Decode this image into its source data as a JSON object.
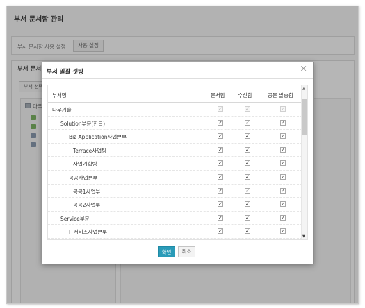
{
  "page": {
    "title": "부서 문서함 관리"
  },
  "setting": {
    "label": "부서 문서함 사용 설정",
    "button": "사용 설정"
  },
  "dept": {
    "title": "부서 문서",
    "select_button": "부서 선택",
    "root_label": "다우"
  },
  "modal": {
    "title": "부서 일괄 셋팅",
    "close_icon": "close-icon",
    "headers": {
      "name": "부서명",
      "doc": "문서함",
      "recv": "수신함",
      "pub": "공문 발송함"
    },
    "rows": [
      {
        "name": "다우기술",
        "indent": 0,
        "disabled": true
      },
      {
        "name": "Solution부문(한글)",
        "indent": 1,
        "disabled": false
      },
      {
        "name": "Biz Application사업본부",
        "indent": 2,
        "disabled": false
      },
      {
        "name": "Terrace사업팀",
        "indent": 3,
        "disabled": false
      },
      {
        "name": "사업기획팀",
        "indent": 3,
        "disabled": false
      },
      {
        "name": "공공사업본부",
        "indent": 2,
        "disabled": false
      },
      {
        "name": "공공1사업부",
        "indent": 3,
        "disabled": false
      },
      {
        "name": "공공2사업부",
        "indent": 3,
        "disabled": false
      },
      {
        "name": "Service부문",
        "indent": 1,
        "disabled": false
      },
      {
        "name": "IT서비스사업본부",
        "indent": 2,
        "disabled": false
      }
    ],
    "ok_button": "확인",
    "cancel_button": "취소",
    "ok_color": "#2a9bb8"
  }
}
